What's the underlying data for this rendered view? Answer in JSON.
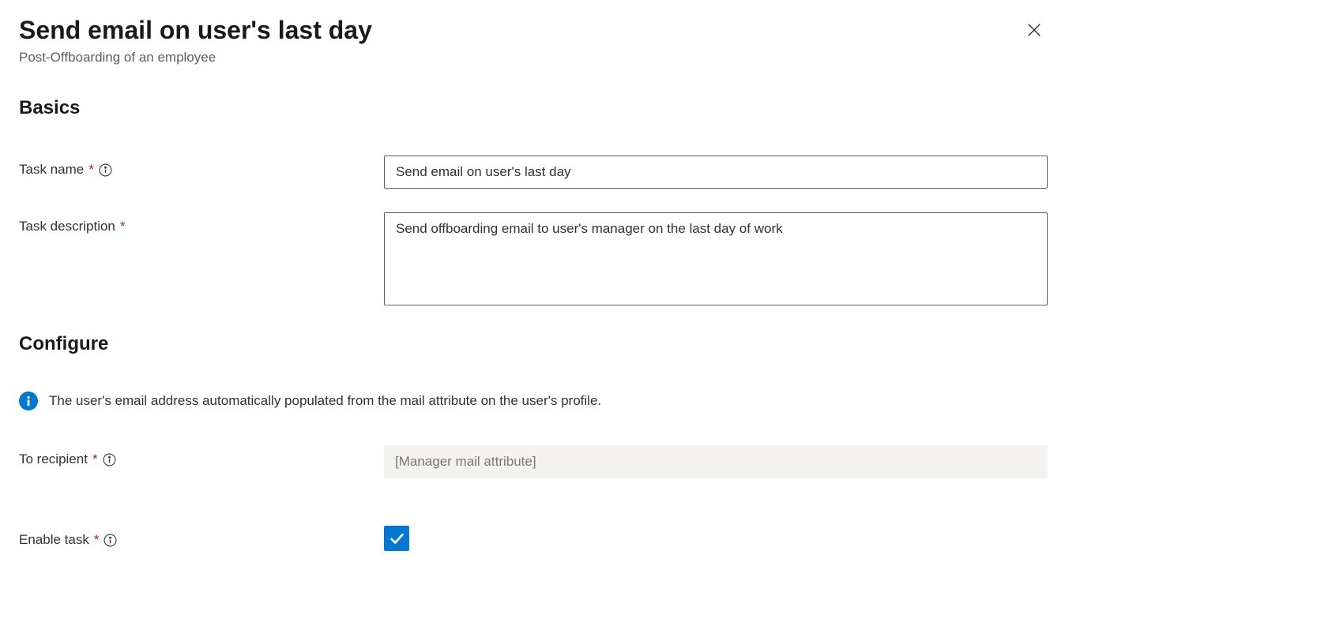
{
  "header": {
    "title": "Send email on user's last day",
    "subtitle": "Post-Offboarding of an employee"
  },
  "sections": {
    "basics": {
      "heading": "Basics",
      "task_name": {
        "label": "Task name",
        "value": "Send email on user's last day"
      },
      "task_description": {
        "label": "Task description",
        "value": "Send offboarding email to user's manager on the last day of work"
      }
    },
    "configure": {
      "heading": "Configure",
      "info_message": "The user's email address automatically populated from the mail attribute on the user's profile.",
      "to_recipient": {
        "label": "To recipient",
        "value": "[Manager mail attribute]"
      },
      "enable_task": {
        "label": "Enable task",
        "checked": true
      }
    }
  }
}
